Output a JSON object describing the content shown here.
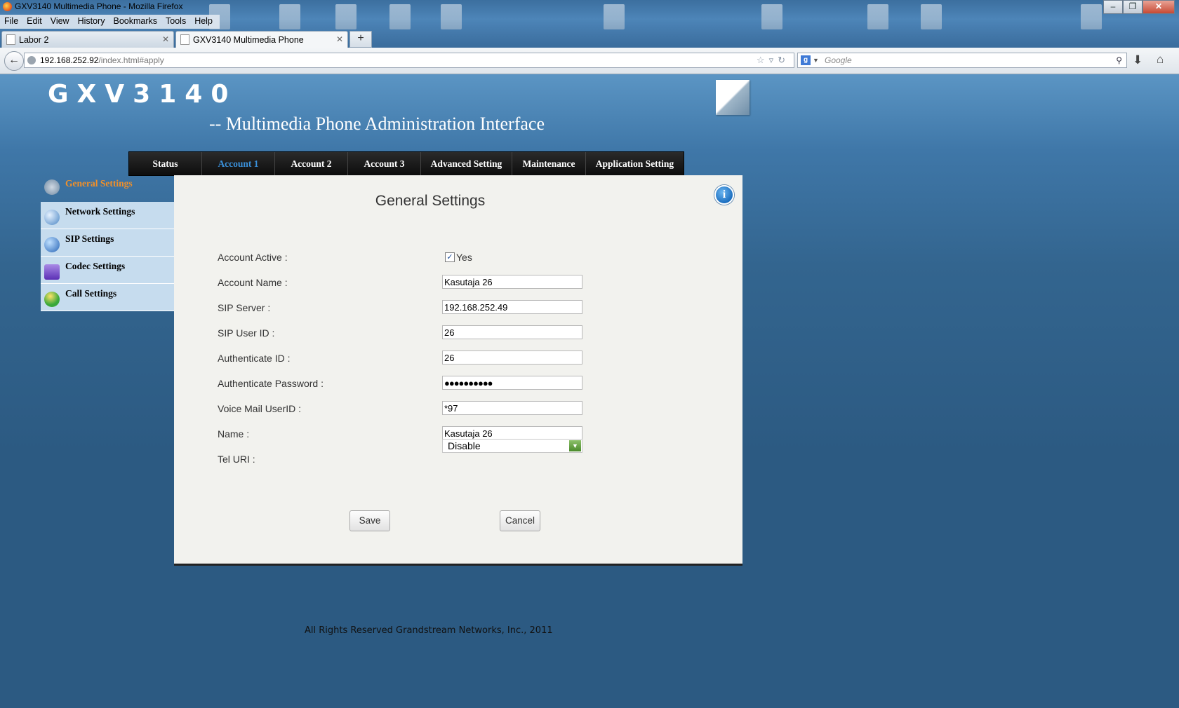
{
  "window": {
    "title": "GXV3140 Multimedia Phone - Mozilla Firefox",
    "controls": {
      "minimize": "‒",
      "restore": "❐",
      "close": "✕"
    }
  },
  "menu": [
    "File",
    "Edit",
    "View",
    "History",
    "Bookmarks",
    "Tools",
    "Help"
  ],
  "tabs": [
    {
      "label": "Labor 2",
      "active": false
    },
    {
      "label": "GXV3140 Multimedia Phone",
      "active": true
    }
  ],
  "new_tab_label": "+",
  "address": {
    "host": "192.168.252.92",
    "path": "/index.html#apply"
  },
  "search": {
    "placeholder": "Google"
  },
  "icons": {
    "back": "back-arrow-icon",
    "bookmark_star": "star-icon",
    "reload": "reload-icon",
    "search": "magnifier-icon",
    "downloads": "download-icon",
    "home": "home-icon",
    "info": "info-icon"
  },
  "page": {
    "brand": "GXV3140",
    "subtitle": "-- Multimedia Phone Administration Interface",
    "nav": [
      {
        "label": "Status",
        "active": false
      },
      {
        "label": "Account 1",
        "active": true
      },
      {
        "label": "Account 2",
        "active": false
      },
      {
        "label": "Account 3",
        "active": false
      },
      {
        "label": "Advanced Setting",
        "active": false
      },
      {
        "label": "Maintenance",
        "active": false
      },
      {
        "label": "Application Setting",
        "active": false
      }
    ],
    "sidebar": [
      {
        "label": "General Settings",
        "active": true
      },
      {
        "label": "Network Settings",
        "active": false
      },
      {
        "label": "SIP Settings",
        "active": false
      },
      {
        "label": "Codec Settings",
        "active": false
      },
      {
        "label": "Call Settings",
        "active": false
      }
    ],
    "panel_title": "General Settings",
    "form": {
      "account_active": {
        "label": "Account Active :",
        "checked": true,
        "check_label": "Yes"
      },
      "account_name": {
        "label": "Account Name :",
        "value": "Kasutaja 26"
      },
      "sip_server": {
        "label": "SIP Server :",
        "value": "192.168.252.49"
      },
      "sip_user_id": {
        "label": "SIP User ID :",
        "value": "26"
      },
      "authenticate_id": {
        "label": "Authenticate ID :",
        "value": "26"
      },
      "authenticate_password": {
        "label": "Authenticate Password :",
        "value": "●●●●●●●●●●"
      },
      "voice_mail_userid": {
        "label": "Voice Mail UserID :",
        "value": "*97"
      },
      "name": {
        "label": "Name :",
        "value": "Kasutaja 26"
      },
      "tel_uri": {
        "label": "Tel URI :",
        "value": "Disable"
      }
    },
    "buttons": {
      "save": "Save",
      "cancel": "Cancel"
    },
    "footer": "All Rights Reserved Grandstream Networks, Inc., 2011"
  },
  "colors": {
    "page_bg": "#2c5a82",
    "active_nav": "#3a8fd8",
    "active_sidebar": "#f0902a",
    "sidebar_bg": "#c6dcee",
    "panel_bg": "#f2f2ee"
  }
}
